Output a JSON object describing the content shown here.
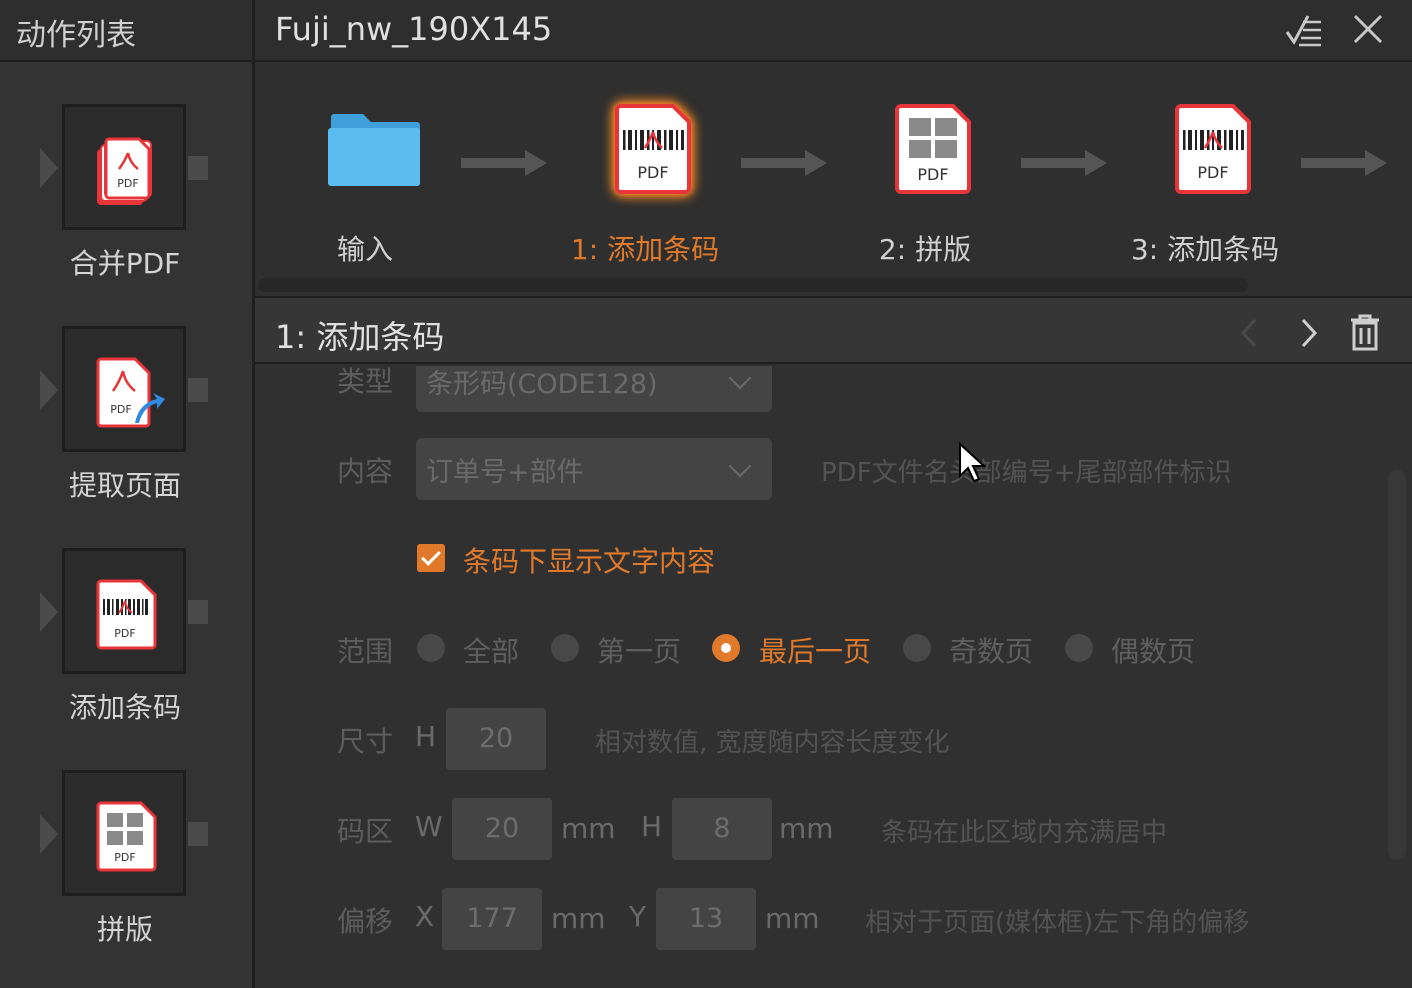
{
  "left_panel": {
    "title": "动作列表",
    "actions": [
      {
        "label": "合并PDF",
        "icon": "merge-pdf-icon"
      },
      {
        "label": "提取页面",
        "icon": "extract-pages-icon"
      },
      {
        "label": "添加条码",
        "icon": "barcode-pdf-icon"
      },
      {
        "label": "拼版",
        "icon": "imposition-pdf-icon"
      }
    ]
  },
  "header": {
    "title": "Fuji_nw_190X145",
    "buttons": [
      "checklist-icon",
      "close-icon"
    ]
  },
  "flow": {
    "steps": [
      {
        "label": "输入",
        "icon": "folder-icon",
        "active": false
      },
      {
        "label": "1: 添加条码",
        "icon": "barcode-pdf-icon",
        "active": true
      },
      {
        "label": "2: 拼版",
        "icon": "imposition-pdf-icon",
        "active": false
      },
      {
        "label": "3: 添加条码",
        "icon": "barcode-pdf-icon",
        "active": false
      }
    ],
    "pdf_text": "PDF"
  },
  "section": {
    "title": "1: 添加条码",
    "buttons": [
      "prev-icon",
      "next-icon",
      "trash-icon"
    ]
  },
  "form": {
    "type_label": "类型",
    "type_value": "条形码(CODE128)",
    "content_label": "内容",
    "content_value": "订单号+部件",
    "content_hint": "PDF文件名头部编号+尾部部件标识",
    "show_text_label": "条码下显示文字内容",
    "show_text_checked": true,
    "range_label": "范围",
    "range_options": [
      "全部",
      "第一页",
      "最后一页",
      "奇数页",
      "偶数页"
    ],
    "range_selected": "最后一页",
    "size_label": "尺寸",
    "size_h_label": "H",
    "size_h_value": "20",
    "size_hint": "相对数值, 宽度随内容长度变化",
    "area_label": "码区",
    "area_w_label": "W",
    "area_w_value": "20",
    "area_h_label": "H",
    "area_h_value": "8",
    "unit": "mm",
    "area_hint": "条码在此区域内充满居中",
    "offset_label": "偏移",
    "offset_x_label": "X",
    "offset_x_value": "177",
    "offset_y_label": "Y",
    "offset_y_value": "13",
    "offset_hint": "相对于页面(媒体框)左下角的偏移"
  },
  "colors": {
    "accent": "#e07a2a",
    "pdf_red": "#e8353a",
    "folder_blue": "#5bbcf0"
  }
}
